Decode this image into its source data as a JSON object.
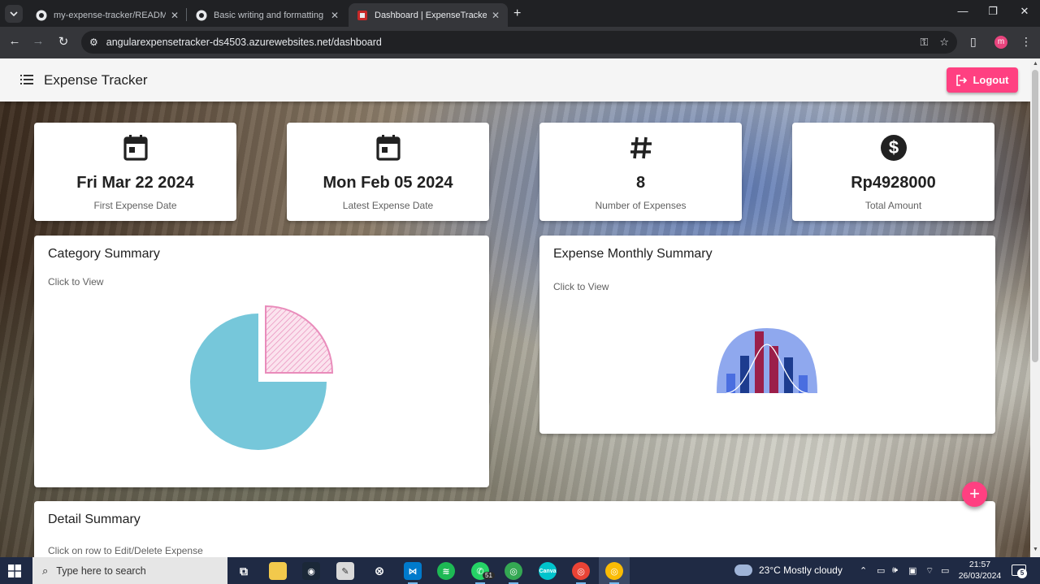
{
  "browser": {
    "tabs": [
      {
        "title": "my-expense-tracker/README.m",
        "active": false
      },
      {
        "title": "Basic writing and formatting sy",
        "active": false
      },
      {
        "title": "Dashboard | ExpenseTracker",
        "active": true
      }
    ],
    "url": "angularexpensetracker-ds4503.azurewebsites.net/dashboard",
    "profile_initial": "m"
  },
  "app": {
    "title": "Expense Tracker",
    "logout_label": "Logout"
  },
  "stats": [
    {
      "icon": "calendar-icon",
      "value": "Fri Mar 22 2024",
      "label": "First Expense Date"
    },
    {
      "icon": "calendar-icon",
      "value": "Mon Feb 05 2024",
      "label": "Latest Expense Date"
    },
    {
      "icon": "hash-icon",
      "value": "8",
      "label": "Number of Expenses"
    },
    {
      "icon": "dollar-icon",
      "value": "Rp4928000",
      "label": "Total Amount"
    }
  ],
  "category_summary": {
    "title": "Category Summary",
    "hint": "Click to View"
  },
  "monthly_summary": {
    "title": "Expense Monthly Summary",
    "hint": "Click to View"
  },
  "detail_summary": {
    "title": "Detail Summary",
    "hint": "Click on row to Edit/Delete Expense"
  },
  "fab_label": "+",
  "taskbar": {
    "search_placeholder": "Type here to search",
    "whatsapp_badge": "51",
    "weather": "23°C  Mostly cloudy",
    "time": "21:57",
    "date": "26/03/2024",
    "notification_count": "5"
  },
  "colors": {
    "accent": "#ff4081",
    "pie_main": "#76c7da",
    "pie_slice": "#f4b6d2",
    "taskbar": "#1f2a44"
  }
}
